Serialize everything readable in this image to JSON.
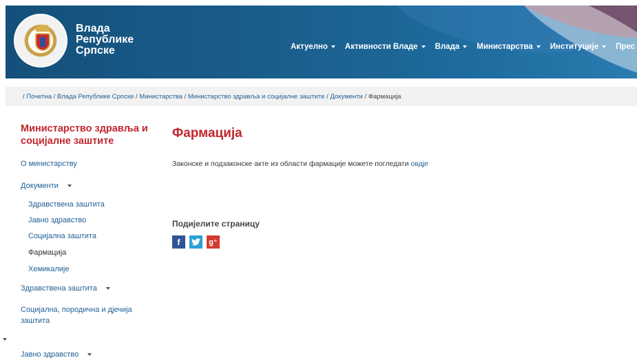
{
  "header": {
    "site_title_lines": [
      "Влада",
      "Републике",
      "Српске"
    ],
    "nav": [
      {
        "label": "Актуелно"
      },
      {
        "label": "Активности Владе"
      },
      {
        "label": "Влада"
      },
      {
        "label": "Министарства"
      },
      {
        "label": "Институције"
      },
      {
        "label": "Прес"
      }
    ]
  },
  "breadcrumb": {
    "items": [
      "Почетна",
      "Влада Републике Српске",
      "Министарства",
      "Министарство здравља и социјалне заштите",
      "Документи"
    ],
    "current": "Фармација",
    "separator": "/"
  },
  "sidebar": {
    "title": "Министарство здравља и социјалне заштите",
    "items": [
      {
        "label": "О министарству"
      },
      {
        "label": "Документи"
      },
      {
        "label": "Здравствена заштита"
      },
      {
        "label": "Јавно здравство"
      },
      {
        "label": "Социјална заштита"
      },
      {
        "label": "Фармација"
      },
      {
        "label": "Хемикалије"
      },
      {
        "label": "Здравствена заштита"
      },
      {
        "label": "Социјална, породична и дјечија"
      },
      {
        "label": "заштита"
      },
      {
        "label": "Јавно здравство"
      }
    ]
  },
  "main": {
    "title": "Фармација",
    "intro_text": "Законске и подзаконске акте из области фармације можете погледати ",
    "intro_link": "овдје",
    "share_title": "Подијелите страницу",
    "share_icons": [
      "facebook-icon",
      "twitter-icon",
      "google-plus-icon"
    ]
  },
  "colors": {
    "header_blue": "#1a5f8e",
    "accent_red": "#c2262e",
    "link_blue": "#1f5e94",
    "breadcrumb_bg": "#f2f2f2"
  }
}
